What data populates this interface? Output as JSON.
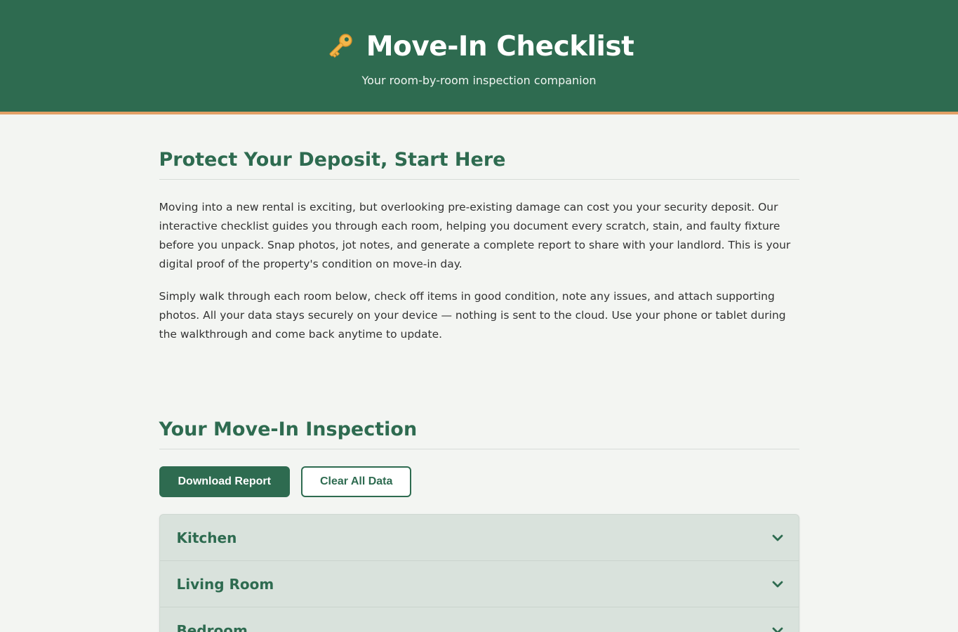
{
  "header": {
    "title": "Move-In Checklist",
    "subtitle": "Your room-by-room inspection companion",
    "icon": "key-icon"
  },
  "intro": {
    "heading": "Protect Your Deposit, Start Here",
    "paragraph1": "Moving into a new rental is exciting, but overlooking pre-existing damage can cost you your security deposit. Our interactive checklist guides you through each room, helping you document every scratch, stain, and faulty fixture before you unpack. Snap photos, jot notes, and generate a complete report to share with your landlord. This is your digital proof of the property's condition on move-in day.",
    "paragraph2": "Simply walk through each room below, check off items in good condition, note any issues, and attach supporting photos. All your data stays securely on your device — nothing is sent to the cloud. Use your phone or tablet during the walkthrough and come back anytime to update."
  },
  "inspection": {
    "heading": "Your Move-In Inspection",
    "download_label": "Download Report",
    "clear_label": "Clear All Data",
    "rooms": [
      {
        "name": "Kitchen"
      },
      {
        "name": "Living Room"
      },
      {
        "name": "Bedroom"
      }
    ]
  },
  "colors": {
    "primary": "#2e6b50",
    "accent": "#e2a066",
    "background": "#f3f5f2",
    "room_bg": "#d9e2dc"
  }
}
